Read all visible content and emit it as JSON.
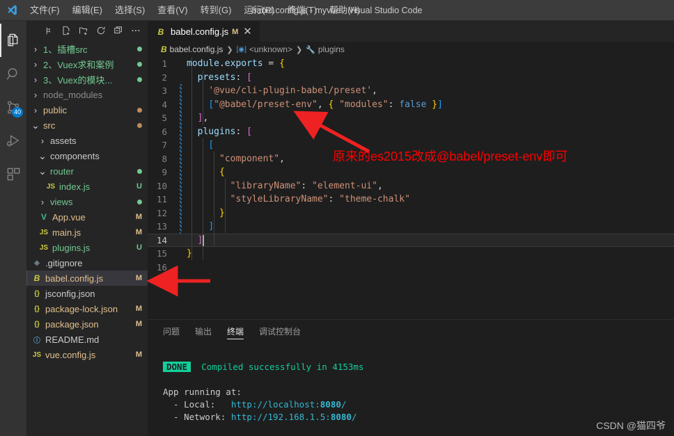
{
  "window": {
    "title": "babel.config.js - myvue - Visual Studio Code",
    "logo_icon": "vscode-logo-icon"
  },
  "menubar": {
    "items": [
      {
        "label": "文件(F)",
        "name": "menu-file"
      },
      {
        "label": "编辑(E)",
        "name": "menu-edit"
      },
      {
        "label": "选择(S)",
        "name": "menu-selection"
      },
      {
        "label": "查看(V)",
        "name": "menu-view"
      },
      {
        "label": "转到(G)",
        "name": "menu-go"
      },
      {
        "label": "运行(R)",
        "name": "menu-run"
      },
      {
        "label": "终端(T)",
        "name": "menu-terminal"
      },
      {
        "label": "帮助(H)",
        "name": "menu-help"
      }
    ]
  },
  "activitybar": {
    "items": [
      {
        "name": "explorer-icon",
        "active": true,
        "badge": ""
      },
      {
        "name": "search-icon",
        "active": false,
        "badge": ""
      },
      {
        "name": "source-control-icon",
        "active": false,
        "badge": "40"
      },
      {
        "name": "run-and-debug-icon",
        "active": false,
        "badge": ""
      },
      {
        "name": "extensions-icon",
        "active": false,
        "badge": ""
      }
    ]
  },
  "explorer": {
    "toolbar": [
      {
        "name": "new-file-icon"
      },
      {
        "name": "new-folder-icon"
      },
      {
        "name": "refresh-icon"
      },
      {
        "name": "collapse-all-icon"
      },
      {
        "name": "more-actions-icon"
      }
    ],
    "tree": [
      {
        "label": "1、插槽src",
        "indent": 0,
        "type": "folder",
        "expanded": false,
        "color": "#73c991",
        "status": "",
        "dot": "#73c991"
      },
      {
        "label": "2、Vuex求和案例",
        "indent": 0,
        "type": "folder",
        "expanded": false,
        "color": "#73c991",
        "status": "",
        "dot": "#73c991"
      },
      {
        "label": "3、Vuex的模块...",
        "indent": 0,
        "type": "folder",
        "expanded": false,
        "color": "#73c991",
        "status": "",
        "dot": "#73c991"
      },
      {
        "label": "node_modules",
        "indent": 0,
        "type": "folder",
        "expanded": false,
        "color": "#8c8c8c",
        "status": "",
        "dot": ""
      },
      {
        "label": "public",
        "indent": 0,
        "type": "folder",
        "expanded": false,
        "color": "#e2c08d",
        "status": "",
        "dot": "#bd8b5c"
      },
      {
        "label": "src",
        "indent": 0,
        "type": "folder",
        "expanded": true,
        "color": "#e2c08d",
        "status": "",
        "dot": "#bd8b5c"
      },
      {
        "label": "assets",
        "indent": 1,
        "type": "folder",
        "expanded": false,
        "color": "#cccccc",
        "status": "",
        "dot": ""
      },
      {
        "label": "components",
        "indent": 1,
        "type": "folder",
        "expanded": true,
        "color": "#cccccc",
        "status": "",
        "dot": ""
      },
      {
        "label": "router",
        "indent": 1,
        "type": "folder",
        "expanded": true,
        "color": "#73c991",
        "status": "",
        "dot": "#73c991"
      },
      {
        "label": "index.js",
        "indent": 2,
        "type": "file",
        "icon": "js-file-icon",
        "iconText": "JS",
        "iconColor": "#cbcb41",
        "color": "#73c991",
        "status": "U",
        "statusColor": "#73c991"
      },
      {
        "label": "views",
        "indent": 1,
        "type": "folder",
        "expanded": false,
        "color": "#73c991",
        "status": "",
        "dot": "#73c991"
      },
      {
        "label": "App.vue",
        "indent": 1,
        "type": "file",
        "icon": "vue-file-icon",
        "iconText": "V",
        "iconColor": "#41b883",
        "color": "#e2c08d",
        "status": "M",
        "statusColor": "#e2c08d"
      },
      {
        "label": "main.js",
        "indent": 1,
        "type": "file",
        "icon": "js-file-icon",
        "iconText": "JS",
        "iconColor": "#cbcb41",
        "color": "#e2c08d",
        "status": "M",
        "statusColor": "#e2c08d"
      },
      {
        "label": "plugins.js",
        "indent": 1,
        "type": "file",
        "icon": "js-file-icon",
        "iconText": "JS",
        "iconColor": "#cbcb41",
        "color": "#73c991",
        "status": "U",
        "statusColor": "#73c991"
      },
      {
        "label": ".gitignore",
        "indent": 0,
        "type": "file",
        "icon": "git-file-icon",
        "iconText": "◈",
        "iconColor": "#6d8086",
        "color": "#cccccc",
        "status": "",
        "statusColor": ""
      },
      {
        "label": "babel.config.js",
        "indent": 0,
        "type": "file",
        "icon": "babel-file-icon",
        "iconText": "B",
        "iconColor": "#cbcb41",
        "color": "#e2c08d",
        "status": "M",
        "statusColor": "#e2c08d",
        "selected": true
      },
      {
        "label": "jsconfig.json",
        "indent": 0,
        "type": "file",
        "icon": "json-file-icon",
        "iconText": "{}",
        "iconColor": "#cbcb41",
        "color": "#cccccc",
        "status": "",
        "statusColor": ""
      },
      {
        "label": "package-lock.json",
        "indent": 0,
        "type": "file",
        "icon": "json-file-icon",
        "iconText": "{}",
        "iconColor": "#cbcb41",
        "color": "#e2c08d",
        "status": "M",
        "statusColor": "#e2c08d"
      },
      {
        "label": "package.json",
        "indent": 0,
        "type": "file",
        "icon": "json-file-icon",
        "iconText": "{}",
        "iconColor": "#cbcb41",
        "color": "#e2c08d",
        "status": "M",
        "statusColor": "#e2c08d"
      },
      {
        "label": "README.md",
        "indent": 0,
        "type": "file",
        "icon": "info-file-icon",
        "iconText": "ⓘ",
        "iconColor": "#519aba",
        "color": "#cccccc",
        "status": "",
        "statusColor": ""
      },
      {
        "label": "vue.config.js",
        "indent": 0,
        "type": "file",
        "icon": "js-file-icon",
        "iconText": "JS",
        "iconColor": "#cbcb41",
        "color": "#e2c08d",
        "status": "M",
        "statusColor": "#e2c08d"
      }
    ]
  },
  "editor": {
    "tab": {
      "icon": "babel-file-icon",
      "icon_text": "B",
      "label": "babel.config.js",
      "status": "M",
      "close_icon": "close-icon"
    },
    "breadcrumb": [
      {
        "icon_text": "B",
        "label": "babel.config.js",
        "name": "breadcrumb-file"
      },
      {
        "icon_text": "[◉]",
        "label": "<unknown>",
        "name": "breadcrumb-symbol-unknown"
      },
      {
        "icon_text": "🔧",
        "label": "plugins",
        "name": "breadcrumb-symbol-plugins"
      }
    ],
    "current_line": 14,
    "lines": [
      {
        "n": 1,
        "tokens": [
          {
            "t": "module",
            "c": "t-var"
          },
          {
            "t": ".",
            "c": "t-punc"
          },
          {
            "t": "exports",
            "c": "t-prop"
          },
          {
            "t": " = ",
            "c": "t-op"
          },
          {
            "t": "{",
            "c": "t-brkt1"
          }
        ]
      },
      {
        "n": 2,
        "tokens": [
          {
            "t": "  ",
            "c": "t-punc"
          },
          {
            "t": "presets",
            "c": "t-var"
          },
          {
            "t": ": ",
            "c": "t-punc"
          },
          {
            "t": "[",
            "c": "t-brkt2"
          }
        ]
      },
      {
        "n": 3,
        "tokens": [
          {
            "t": "    ",
            "c": "t-punc"
          },
          {
            "t": "'@vue/cli-plugin-babel/preset'",
            "c": "t-str"
          },
          {
            "t": ",",
            "c": "t-punc"
          }
        ]
      },
      {
        "n": 4,
        "tokens": [
          {
            "t": "    ",
            "c": "t-punc"
          },
          {
            "t": "[",
            "c": "t-brkt3"
          },
          {
            "t": "\"@babel/preset-env\"",
            "c": "t-str"
          },
          {
            "t": ", ",
            "c": "t-punc"
          },
          {
            "t": "{",
            "c": "t-brkt1"
          },
          {
            "t": " ",
            "c": "t-punc"
          },
          {
            "t": "\"modules\"",
            "c": "t-str"
          },
          {
            "t": ": ",
            "c": "t-punc"
          },
          {
            "t": "false",
            "c": "t-key"
          },
          {
            "t": " ",
            "c": "t-punc"
          },
          {
            "t": "}",
            "c": "t-brkt1"
          },
          {
            "t": "]",
            "c": "t-brkt3"
          }
        ]
      },
      {
        "n": 5,
        "tokens": [
          {
            "t": "  ",
            "c": "t-punc"
          },
          {
            "t": "]",
            "c": "t-brkt2"
          },
          {
            "t": ",",
            "c": "t-punc"
          }
        ]
      },
      {
        "n": 6,
        "tokens": [
          {
            "t": "  ",
            "c": "t-punc"
          },
          {
            "t": "plugins",
            "c": "t-var"
          },
          {
            "t": ": ",
            "c": "t-punc"
          },
          {
            "t": "[",
            "c": "t-brkt2"
          }
        ]
      },
      {
        "n": 7,
        "tokens": [
          {
            "t": "    ",
            "c": "t-punc"
          },
          {
            "t": "[",
            "c": "t-brkt3"
          }
        ]
      },
      {
        "n": 8,
        "tokens": [
          {
            "t": "      ",
            "c": "t-punc"
          },
          {
            "t": "\"component\"",
            "c": "t-str"
          },
          {
            "t": ",",
            "c": "t-punc"
          }
        ]
      },
      {
        "n": 9,
        "tokens": [
          {
            "t": "      ",
            "c": "t-punc"
          },
          {
            "t": "{",
            "c": "t-brkt1"
          }
        ]
      },
      {
        "n": 10,
        "tokens": [
          {
            "t": "        ",
            "c": "t-punc"
          },
          {
            "t": "\"libraryName\"",
            "c": "t-str"
          },
          {
            "t": ": ",
            "c": "t-punc"
          },
          {
            "t": "\"element-ui\"",
            "c": "t-str"
          },
          {
            "t": ",",
            "c": "t-punc"
          }
        ]
      },
      {
        "n": 11,
        "tokens": [
          {
            "t": "        ",
            "c": "t-punc"
          },
          {
            "t": "\"styleLibraryName\"",
            "c": "t-str"
          },
          {
            "t": ": ",
            "c": "t-punc"
          },
          {
            "t": "\"theme-chalk\"",
            "c": "t-str"
          }
        ]
      },
      {
        "n": 12,
        "tokens": [
          {
            "t": "      ",
            "c": "t-punc"
          },
          {
            "t": "}",
            "c": "t-brkt1"
          }
        ]
      },
      {
        "n": 13,
        "tokens": [
          {
            "t": "    ",
            "c": "t-punc"
          },
          {
            "t": "]",
            "c": "t-brkt3"
          }
        ]
      },
      {
        "n": 14,
        "tokens": [
          {
            "t": "  ",
            "c": "t-punc"
          },
          {
            "t": "]",
            "c": "t-brkt2"
          }
        ]
      },
      {
        "n": 15,
        "tokens": [
          {
            "t": "}",
            "c": "t-brkt1"
          }
        ]
      },
      {
        "n": 16,
        "tokens": []
      }
    ]
  },
  "panel": {
    "tabs": [
      {
        "label": "问题",
        "name": "panel-tab-problems",
        "active": false
      },
      {
        "label": "输出",
        "name": "panel-tab-output",
        "active": false
      },
      {
        "label": "终端",
        "name": "panel-tab-terminal",
        "active": true
      },
      {
        "label": "调试控制台",
        "name": "panel-tab-debug-console",
        "active": false
      }
    ],
    "terminal": {
      "done_badge": "DONE",
      "done_message": "Compiled successfully in 4153ms",
      "app_running_label": "App running at:",
      "local_label": "  - Local:   ",
      "local_url": "http://localhost:",
      "local_port": "8080",
      "local_tail": "/",
      "network_label": "  - Network: ",
      "network_url": "http://192.168.1.5:",
      "network_port": "8080",
      "network_tail": "/"
    }
  },
  "annotations": {
    "note_text": "原来的es2015改成@babel/preset-env即可",
    "arrow_color": "#ee2222",
    "watermark": "CSDN @猫四爷"
  }
}
